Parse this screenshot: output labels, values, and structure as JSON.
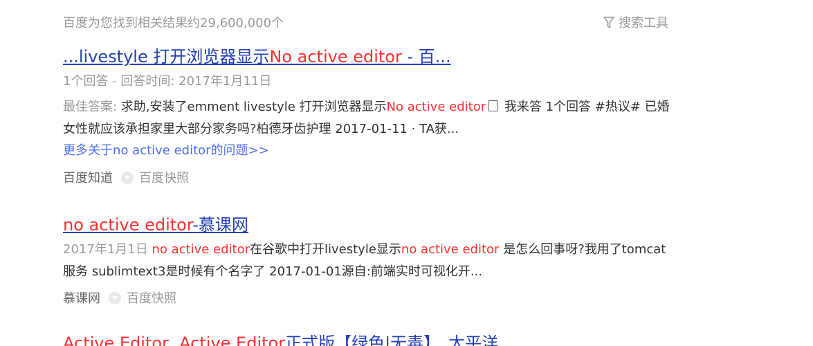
{
  "topbar": {
    "stats": "百度为您找到相关结果约29,600,000个",
    "tools_label": "搜索工具",
    "tools_icon": "filter-icon"
  },
  "results": [
    {
      "title_prefix": "...livestyle 打开浏览器显示",
      "title_hl": "No active editor",
      "title_suffix": " - 百...",
      "meta": "1个回答 - 回答时间: 2017年1月11日",
      "abstract_label": "最佳答案: ",
      "abstract_pre": "求助,安装了emment livestyle 打开浏览器显示",
      "abstract_hl": "No active editor",
      "abstract_post": " 我来答 1个回答 #热议# 已婚女性就应该承担家里大部分家务吗?柏德牙齿护理 2017-01-11 · TA获...",
      "more_link": "更多关于no active editor的问题>>",
      "source": "百度知道",
      "cache": "百度快照"
    },
    {
      "title_hl": "no active editor",
      "title_suffix": "-慕课网",
      "date": "2017年1月1日 ",
      "abstract_hl1": "no active editor",
      "abstract_mid": "在谷歌中打开livestyle显示",
      "abstract_hl2": "no active editor",
      "abstract_post": " 是怎么回事呀?我用了tomcat服务 sublimtext3是时候有个名字了 2017-01-01源自:前端实时可视化开...",
      "source": "慕课网",
      "cache": "百度快照"
    },
    {
      "title_hl1": "Active Editor",
      "title_sep": ", ",
      "title_hl2": "Active Editor",
      "title_suffix": "正式版【绿色|无毒】_太平洋..."
    }
  ],
  "colors": {
    "link": "#2440b3",
    "highlight": "#f73131",
    "muted": "#999999",
    "text": "#333333"
  }
}
